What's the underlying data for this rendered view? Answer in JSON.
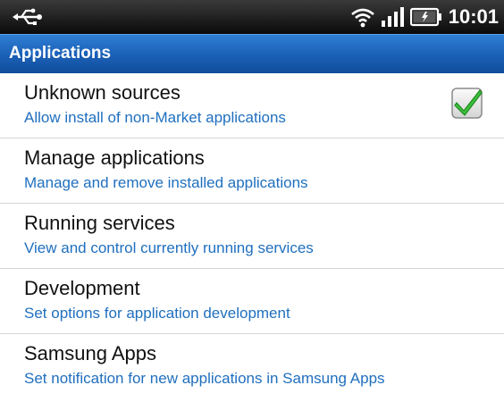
{
  "status_bar": {
    "time": "10:01",
    "icons": [
      "usb-icon",
      "wifi-icon",
      "signal-icon",
      "battery-icon"
    ]
  },
  "header": {
    "title": "Applications"
  },
  "settings": {
    "items": [
      {
        "title": "Unknown sources",
        "summary": "Allow install of non-Market applications",
        "checked": true
      },
      {
        "title": "Manage applications",
        "summary": "Manage and remove installed applications"
      },
      {
        "title": "Running services",
        "summary": "View and control currently running services"
      },
      {
        "title": "Development",
        "summary": "Set options for application development"
      },
      {
        "title": "Samsung Apps",
        "summary": "Set notification for new applications in Samsung Apps"
      }
    ]
  },
  "colors": {
    "title_bar": "#1a5fb6",
    "summary_text": "#1f6fbf",
    "check_green": "#3cc03c"
  }
}
